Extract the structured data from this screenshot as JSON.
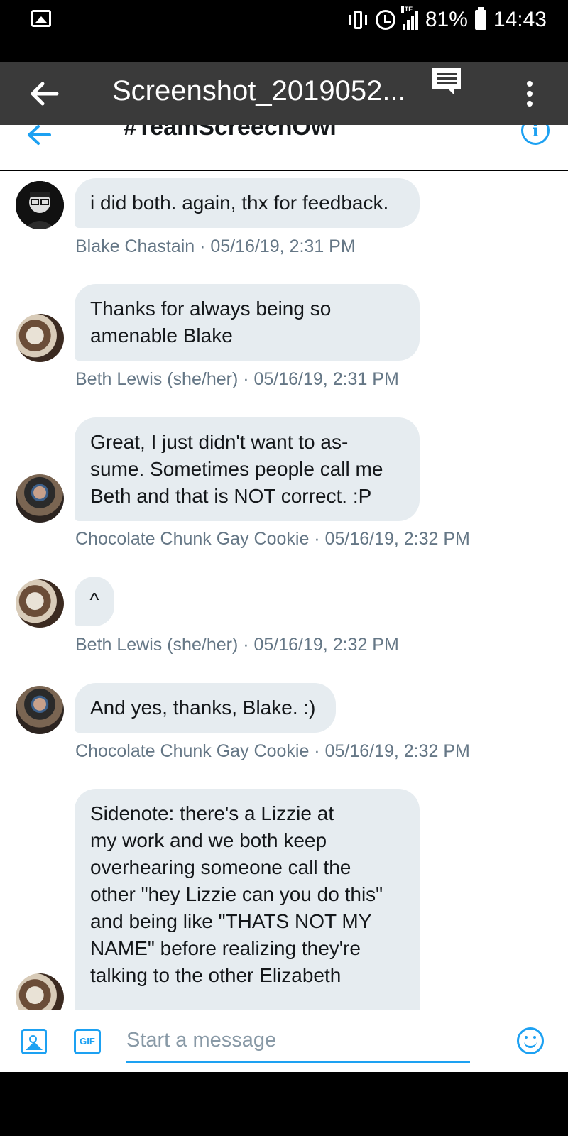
{
  "status_bar": {
    "battery": "81%",
    "time": "14:43",
    "network": "LTE"
  },
  "viewer": {
    "title": "Screenshot_2019052...",
    "icons": [
      "back-arrow-icon",
      "comment-icon",
      "overflow-menu-icon"
    ]
  },
  "dm_header": {
    "title": "#TeamScreechOwl",
    "icons": [
      "back-arrow-icon",
      "info-icon"
    ]
  },
  "messages": [
    {
      "lines": [
        "i did both. again, thx for feedback."
      ],
      "meta": "Blake Chastain · 05/16/19, 2:31 PM"
    },
    {
      "lines": [
        "Thanks for always being so",
        "amenable Blake"
      ],
      "meta": "Beth Lewis (she/her) · 05/16/19, 2:31 PM"
    },
    {
      "lines": [
        "Great, I just didn't want to as-",
        "sume. Sometimes people call me",
        "Beth and that is NOT correct. :P"
      ],
      "meta": "Chocolate Chunk Gay Cookie · 05/16/19, 2:32 PM"
    },
    {
      "lines": [
        "^"
      ],
      "meta": "Beth Lewis (she/her) · 05/16/19, 2:32 PM"
    },
    {
      "lines": [
        "And yes, thanks, Blake. :)"
      ],
      "meta": "Chocolate Chunk Gay Cookie · 05/16/19, 2:32 PM"
    },
    {
      "lines": [
        "Sidenote: there's a Lizzie at",
        "my work and we both keep",
        "overhearing someone call the",
        "other \"hey Lizzie can you do this\"",
        "and being like \"THATS NOT MY",
        "NAME\" before realizing they're",
        "talking to the other Elizabeth"
      ],
      "meta": ""
    }
  ],
  "composer": {
    "placeholder": "Start a message",
    "gif_label": "GIF"
  },
  "colors": {
    "accent": "#1da1f2",
    "bubble": "#e6ecf0",
    "meta_text": "#657786"
  }
}
